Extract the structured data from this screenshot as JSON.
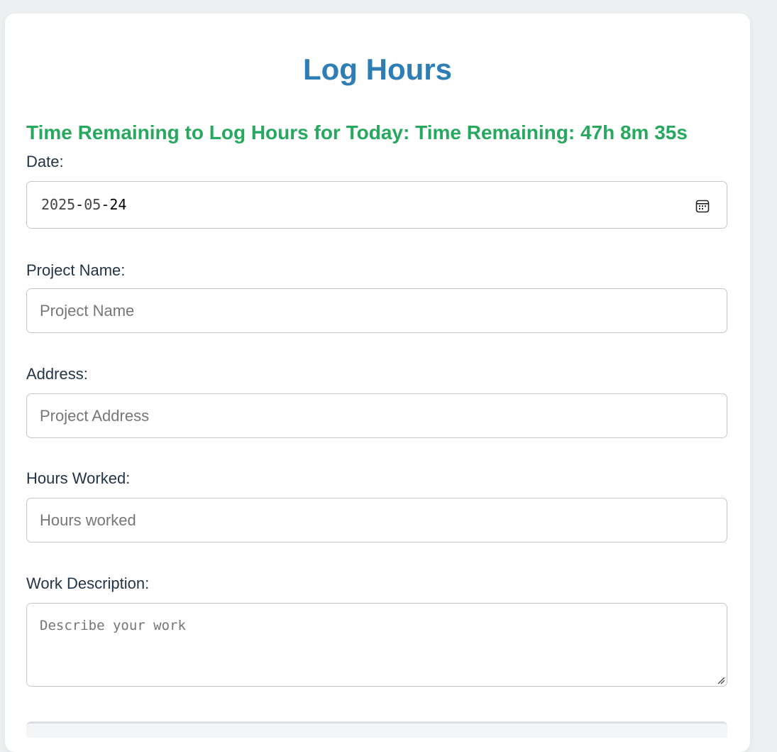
{
  "page": {
    "title": "Log Hours",
    "timer_text": "Time Remaining to Log Hours for Today: Time Remaining: 47h 8m 35s"
  },
  "form": {
    "date": {
      "label": "Date:",
      "value": "2025-05-24",
      "year": "2025",
      "month": "05",
      "day": "24",
      "icon": "calendar-icon"
    },
    "project_name": {
      "label": "Project Name:",
      "placeholder": "Project Name"
    },
    "address": {
      "label": "Address:",
      "placeholder": "Project Address"
    },
    "hours_worked": {
      "label": "Hours Worked:",
      "placeholder": "Hours worked"
    },
    "work_description": {
      "label": "Work Description:",
      "placeholder": "Describe your work"
    }
  },
  "colors": {
    "title": "#2e7db5",
    "timer": "#27a85f",
    "background": "#ecf0f1"
  }
}
